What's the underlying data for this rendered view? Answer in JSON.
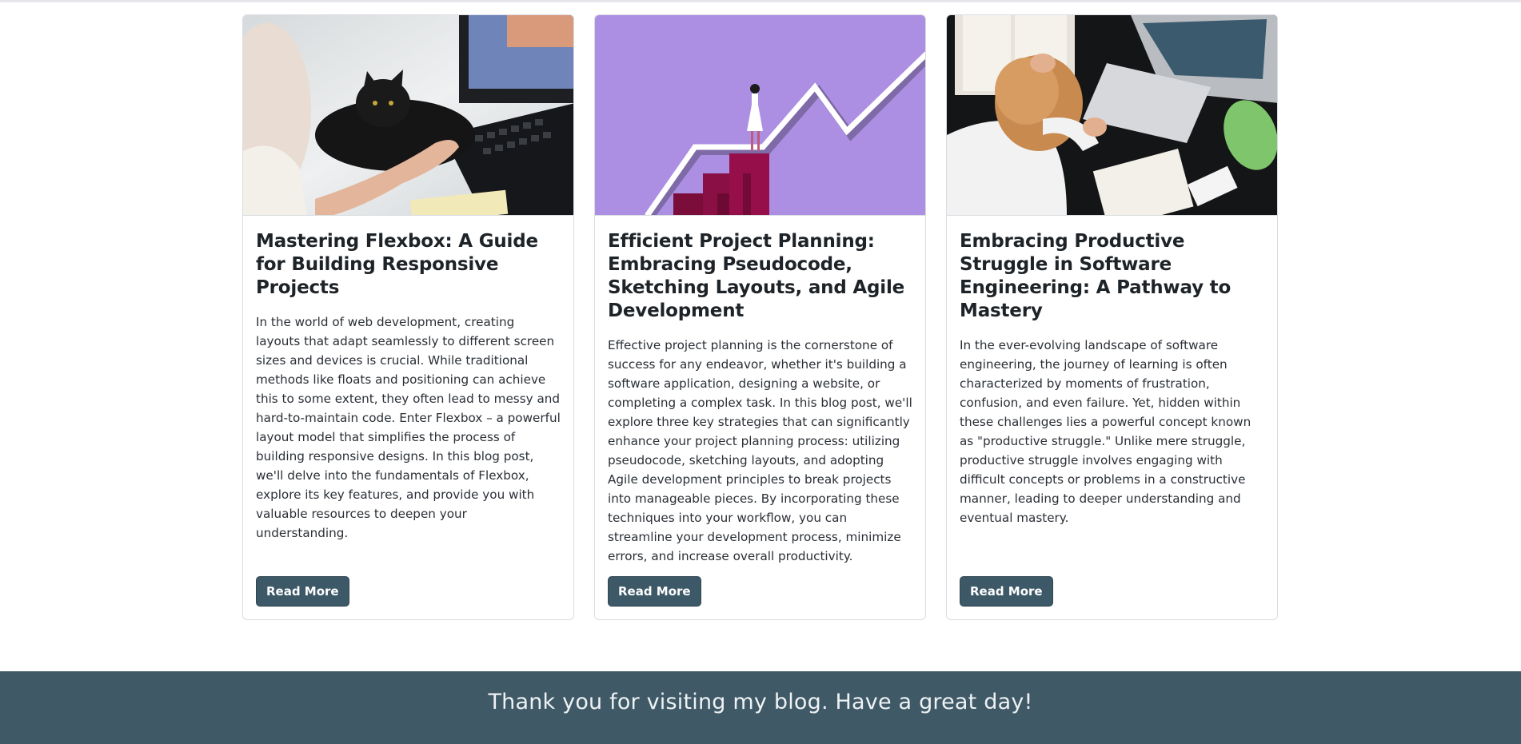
{
  "posts": [
    {
      "image": "photo of a black cat lying next to a computer keyboard",
      "title": "Mastering Flexbox: A Guide for Building Responsive Projects",
      "excerpt": "In the world of web development, creating layouts that adapt seamlessly to different screen sizes and devices is crucial. While traditional methods like floats and positioning can achieve this to some extent, they often lead to messy and hard-to-maintain code. Enter Flexbox – a powerful layout model that simplifies the process of building responsive designs. In this blog post, we'll delve into the fundamentals of Flexbox, explore its key features, and provide you with valuable resources to deepen your understanding.",
      "button_label": "Read More"
    },
    {
      "image": "illustration of a woman on top of a rising bar chart on a purple background",
      "title": "Efficient Project Planning: Embracing Pseudocode, Sketching Layouts, and Agile Development",
      "excerpt": "Effective project planning is the cornerstone of success for any endeavor, whether it's building a software application, designing a website, or completing a complex task. In this blog post, we'll explore three key strategies that can significantly enhance your project planning process: utilizing pseudocode, sketching layouts, and adopting Agile development principles to break projects into manageable pieces. By incorporating these techniques into your workflow, you can streamline your development process, minimize errors, and increase overall productivity.",
      "button_label": "Read More"
    },
    {
      "image": "photo of a stressed person holding their head over a desk with a laptop",
      "title": "Embracing Productive Struggle in Software Engineering: A Pathway to Mastery",
      "excerpt": "In the ever-evolving landscape of software engineering, the journey of learning is often characterized by moments of frustration, confusion, and even failure. Yet, hidden within these challenges lies a powerful concept known as \"productive struggle.\" Unlike mere struggle, productive struggle involves engaging with difficult concepts or problems in a constructive manner, leading to deeper understanding and eventual mastery.",
      "button_label": "Read More"
    }
  ],
  "footer": {
    "message": "Thank you for visiting my blog. Have a great day!"
  },
  "colors": {
    "accent": "#3d5866",
    "footer_bg": "#3f5966",
    "illustration_bg": "#ac8fe3"
  }
}
